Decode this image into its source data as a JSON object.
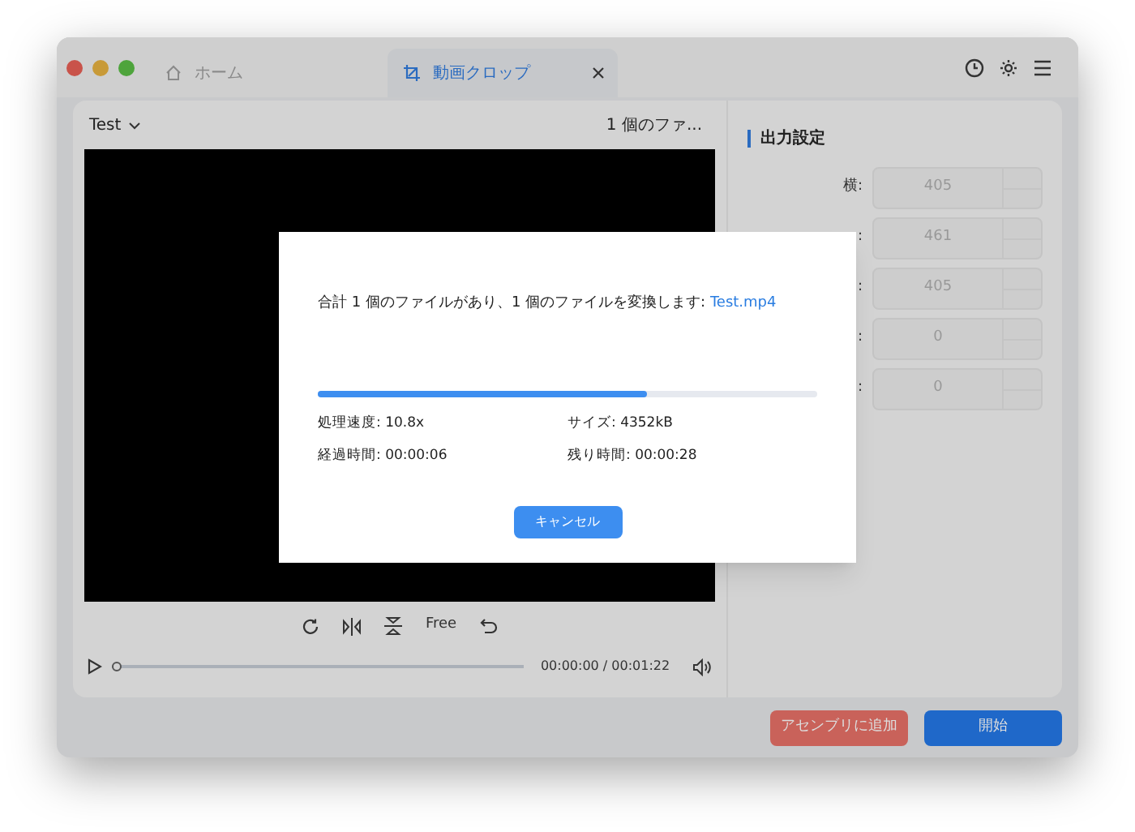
{
  "tabs": [
    {
      "label": "ホーム",
      "selected": false,
      "closable": false
    },
    {
      "label": "動画クロップ",
      "selected": true,
      "closable": true
    }
  ],
  "left_panel": {
    "preset": "Test",
    "file_info": "1 個のファ...",
    "toolbar_label": "Free",
    "time": "00:00:00 / 00:01:22",
    "level": 0.0
  },
  "output_settings": {
    "title": "出力設定",
    "fields": [
      {
        "label": "横:",
        "value": "405"
      },
      {
        "label": ":",
        "value": "461"
      },
      {
        "label": ":",
        "value": "405"
      },
      {
        "label": ":",
        "value": "0"
      },
      {
        "label": ":",
        "value": "0"
      }
    ]
  },
  "buttons": [
    {
      "label": "アセンブリに追加",
      "kind": "secondary"
    },
    {
      "label": "開始",
      "kind": "primary"
    }
  ],
  "dialog": {
    "message": "合計 1 個のファイルがあり、1 個のファイルを変換します: ",
    "file": "Test.mp4",
    "level": 0.66,
    "stats": [
      "処理速度: 10.8x",
      "サイズ: 4352kB",
      "経過時間: 00:00:06",
      "残り時間: 00:00:28"
    ],
    "cancel": "キャンセル"
  }
}
